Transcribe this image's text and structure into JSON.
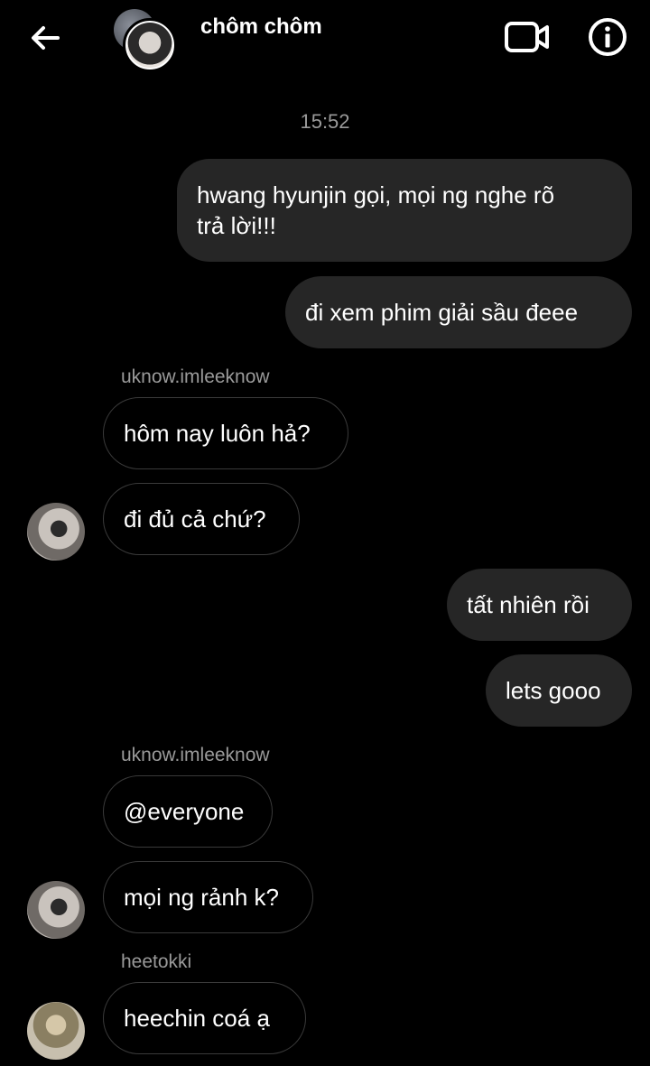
{
  "header": {
    "title": "chôm chôm",
    "back_icon": "arrow-left-icon",
    "video_icon": "video-camera-icon",
    "info_icon": "info-icon"
  },
  "timestamp": "15:52",
  "messages": {
    "m1": {
      "line1": "hwang hyunjin gọi, mọi ng nghe rõ",
      "line2": "trả lời!!!"
    },
    "m2": "đi xem phim giải sầu đeee",
    "sender1": "uknow.imleeknow",
    "m3": "hôm nay luôn hả?",
    "m4": "đi đủ cả chứ?",
    "m5": "tất nhiên rồi",
    "m6": "lets gooo",
    "sender2": "uknow.imleeknow",
    "m7": "@everyone",
    "m8": "mọi ng rảnh k?",
    "sender3": "heetokki",
    "m9": "heechin coá ạ"
  },
  "colors": {
    "background": "#000000",
    "outgoing_bubble": "#262626",
    "incoming_border": "#3a3a3a",
    "muted_text": "#9a9a9a"
  }
}
